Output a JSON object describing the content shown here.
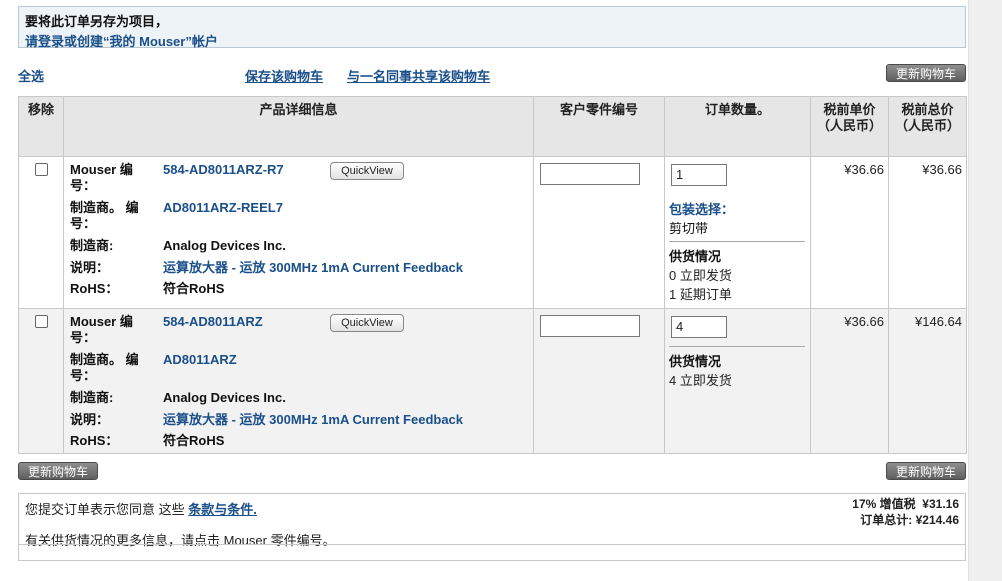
{
  "notice": {
    "line1": "要将此订单另存为项目，",
    "line2": "请登录或创建“我的 Mouser”帐户"
  },
  "toolbar": {
    "select_all": "全选",
    "save_cart": "保存该购物车",
    "share_cart": "与一名同事共享该购物车",
    "update_cart": "更新购物车"
  },
  "table": {
    "headers": {
      "remove": "移除",
      "details": "产品详细信息",
      "customer_part": "客户零件编号",
      "quantity": "订单数量。",
      "unit_price": "税前单价（人民币）",
      "ext_price": "税前总价（人民币）"
    },
    "labels": {
      "mouser_no": "Mouser 编号：",
      "mfr_no": "制造商。 编号：",
      "manufacturer": "制造商:",
      "description": "说明：",
      "rohs": "RoHS："
    },
    "quickview": "QuickView",
    "rows": [
      {
        "mouser_no": "584-AD8011ARZ-R7",
        "mfr_no": "AD8011ARZ-REEL7",
        "manufacturer": "Analog Devices Inc.",
        "description": "运算放大器 - 运放 300MHz 1mA Current Feedback",
        "rohs": "符合RoHS",
        "customer_part": "",
        "quantity": "1",
        "package_label": "包装选择：",
        "package_value": "剪切带",
        "avail_title": "供货情况",
        "avail_line1": "0 立即发货",
        "avail_line2": "1 延期订单",
        "unit_price": "¥36.66",
        "ext_price": "¥36.66"
      },
      {
        "mouser_no": "584-AD8011ARZ",
        "mfr_no": "AD8011ARZ",
        "manufacturer": "Analog Devices Inc.",
        "description": "运算放大器 - 运放 300MHz 1mA Current Feedback",
        "rohs": "符合RoHS",
        "customer_part": "",
        "quantity": "4",
        "avail_title": "供货情况",
        "avail_line1": "4 立即发货",
        "unit_price": "¥36.66",
        "ext_price": "¥146.64"
      }
    ]
  },
  "footer": {
    "terms_prefix": "您提交订单表示您同意 这些",
    "terms_link": "条款与条件.",
    "availability_info": "有关供货情况的更多信息，请点击 Mouser 零件编号。",
    "vat_label": "17% 增值税",
    "vat_value": "¥31.16",
    "total_label": "订单总计:",
    "total_value": "¥214.46"
  }
}
